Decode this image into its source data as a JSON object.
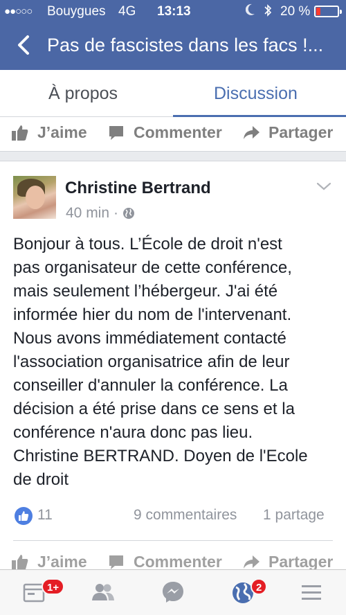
{
  "status_bar": {
    "signal": "●●○○○",
    "carrier": "Bouygues",
    "network": "4G",
    "time": "13:13",
    "battery_percent": "20 %",
    "battery_level": 0.2,
    "icons": [
      "moon-icon",
      "bluetooth-icon",
      "battery-icon"
    ]
  },
  "nav": {
    "title": "Pas de fascistes dans les facs !...",
    "back_icon": "back-chevron-icon"
  },
  "tabs": [
    {
      "label": "À propos",
      "active": false
    },
    {
      "label": "Discussion",
      "active": true
    }
  ],
  "top_actions": {
    "like": "J’aime",
    "comment": "Commenter",
    "share": "Partager"
  },
  "post": {
    "author": "Christine Bertrand",
    "time": "40 min",
    "separator": "·",
    "privacy_icon": "globe-icon",
    "menu_icon": "chevron-down-icon",
    "body_lines": [
      "Bonjour à tous. L’École de droit n'est",
      "pas organisateur de cette conférence,",
      "mais seulement l’hébergeur. J'ai été",
      "informée hier du nom de l'intervenant.",
      "Nous avons immédiatement contacté",
      "l'association organisatrice afin de leur",
      "conseiller d'annuler la conférence. La",
      "décision a été prise dans ce sens et la",
      "conférence n'aura donc pas lieu.",
      "Christine BERTRAND. Doyen de l'Ecole",
      "de droit"
    ],
    "likes": "11",
    "comments": "9 commentaires",
    "shares": "1 partage",
    "actions": {
      "like": "J’aime",
      "comment": "Commenter",
      "share": "Partager"
    }
  },
  "bottom_bar": {
    "items": [
      {
        "icon": "news-feed-icon",
        "badge": "1+"
      },
      {
        "icon": "friends-icon",
        "badge": ""
      },
      {
        "icon": "messenger-icon",
        "badge": ""
      },
      {
        "icon": "notifications-globe-icon",
        "badge": "2"
      },
      {
        "icon": "menu-icon",
        "badge": ""
      }
    ]
  },
  "colors": {
    "header": "#4b67a5",
    "accent": "#4a6eb0",
    "badge": "#e41e25",
    "like_badge": "#4e7fe1"
  }
}
